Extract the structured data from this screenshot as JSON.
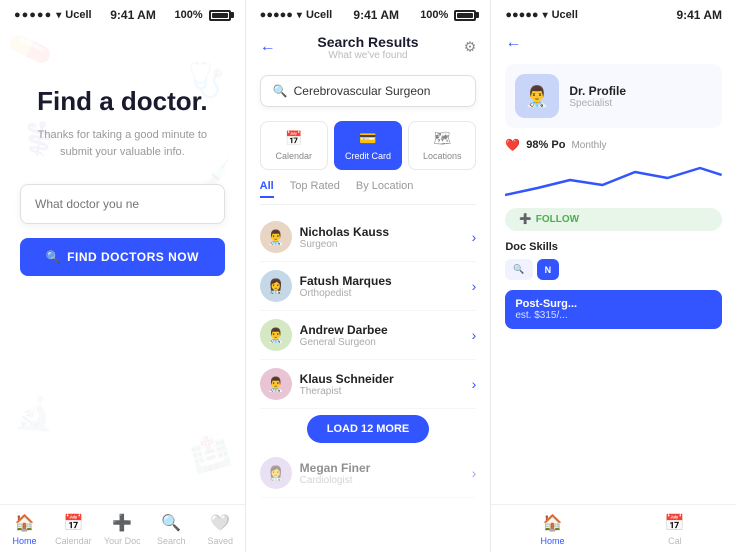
{
  "screen1": {
    "status": {
      "dots": "●●●●●",
      "carrier": "Ucell",
      "time": "9:41 AM",
      "battery": "100%"
    },
    "hero": {
      "title": "Find a doctor.",
      "subtitle": "Thanks for taking a good minute to submit your valuable info."
    },
    "search": {
      "placeholder": "What doctor you ne"
    },
    "find_btn": "FIND DOCTORS NOW",
    "nav": [
      {
        "label": "Home",
        "active": true
      },
      {
        "label": "Calendar",
        "active": false
      },
      {
        "label": "Your Doc",
        "active": false
      },
      {
        "label": "Search",
        "active": false
      },
      {
        "label": "Saved",
        "active": false
      }
    ]
  },
  "screen2": {
    "status": {
      "dots": "●●●●●",
      "carrier": "Ucell",
      "time": "9:41 AM",
      "battery": "100%"
    },
    "header": {
      "title": "Search Results",
      "subtitle": "What we've found"
    },
    "search_value": "Cerebrovascular Surgeon",
    "categories": [
      {
        "label": "Calendar",
        "active": false
      },
      {
        "label": "Credit Card",
        "active": true
      },
      {
        "label": "Locations",
        "active": false
      }
    ],
    "filters": [
      {
        "label": "All",
        "active": true
      },
      {
        "label": "Top Rated",
        "active": false
      },
      {
        "label": "By Location",
        "active": false
      }
    ],
    "doctors": [
      {
        "name": "Nicholas Kauss",
        "specialty": "Surgeon",
        "color": "av1"
      },
      {
        "name": "Fatush Marques",
        "specialty": "Orthopedist",
        "color": "av2"
      },
      {
        "name": "Andrew Darbee",
        "specialty": "General Surgeon",
        "color": "av3"
      },
      {
        "name": "Klaus Schneider",
        "specialty": "Therapist",
        "color": "av4"
      },
      {
        "name": "Megan Finer",
        "specialty": "Cardiologist",
        "color": "av5"
      }
    ],
    "load_more": "LOAD 12 MORE"
  },
  "screen3": {
    "status": {
      "dots": "●●●●●",
      "carrier": "Ucell",
      "time": "9:41 AM"
    },
    "stat": {
      "percent": "98% Po",
      "label": "Monthly"
    },
    "follow_label": "FOLLOW",
    "skills_title": "Doc Skills",
    "skills": [
      {
        "label": "🔍",
        "type": "blue"
      },
      {
        "label": "N",
        "type": "blue-solid"
      },
      {
        "label": "Post-Surgi...",
        "type": "blue-solid"
      }
    ],
    "post_surg": {
      "title": "Post-Surg...",
      "price": "est. $315/..."
    },
    "nav": [
      {
        "label": "Home",
        "active": true
      },
      {
        "label": "Cal",
        "active": false
      }
    ]
  }
}
